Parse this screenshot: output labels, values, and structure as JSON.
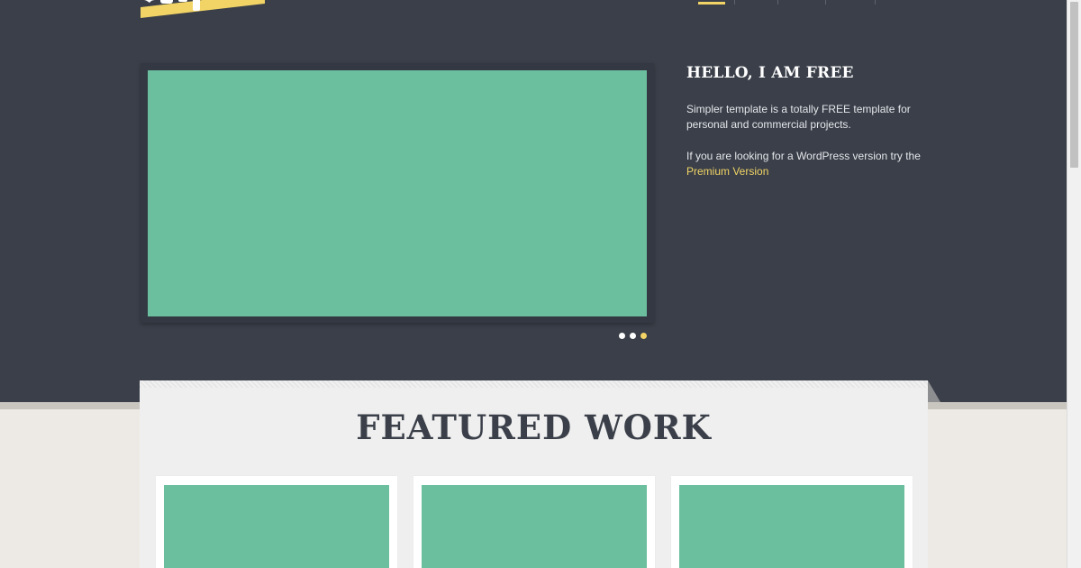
{
  "hero": {
    "title": "HELLO, I AM FREE",
    "paragraph1": "Simpler template is a totally FREE template for personal and commercial projects.",
    "paragraph2_prefix": "If you are looking for a WordPress version try the",
    "premium_link": "Premium Version"
  },
  "slider": {
    "dots": 3,
    "active_dot": 3
  },
  "featured": {
    "title": "FEATURED WORK",
    "cards": 3
  },
  "colors": {
    "hero_background": "#3a3f49",
    "accent": "#f2d466",
    "image_placeholder": "#6bbf9f",
    "page_background": "#edeae5",
    "panel_background": "#efefef"
  }
}
